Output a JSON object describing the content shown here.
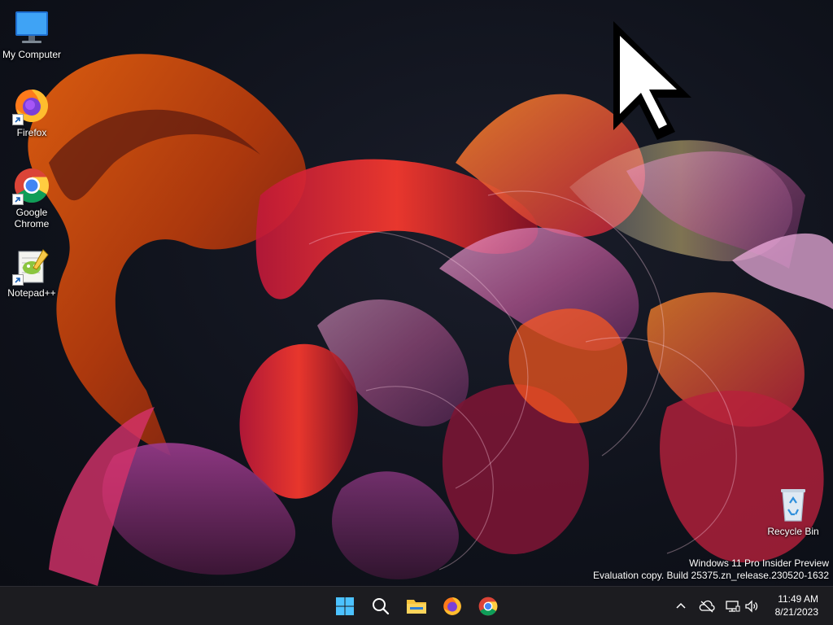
{
  "desktop": {
    "icons": [
      {
        "label": "My Computer",
        "icon": "computer-icon"
      },
      {
        "label": "Firefox",
        "icon": "firefox-icon",
        "shortcut": true
      },
      {
        "label": "Google Chrome",
        "icon": "chrome-icon",
        "shortcut": true
      },
      {
        "label": "Notepad++",
        "icon": "notepadpp-icon",
        "shortcut": true
      },
      {
        "label": "Recycle Bin",
        "icon": "recycle-bin-icon"
      }
    ],
    "watermark": {
      "line1": "Windows 11 Pro Insider Preview",
      "line2": "Evaluation copy. Build 25375.zn_release.230520-1632"
    }
  },
  "taskbar": {
    "pinned": [
      {
        "name": "start-button",
        "icon": "windows-logo-icon"
      },
      {
        "name": "search-button",
        "icon": "search-icon"
      },
      {
        "name": "file-explorer-button",
        "icon": "folder-icon"
      },
      {
        "name": "firefox-taskbar-button",
        "icon": "firefox-icon"
      },
      {
        "name": "chrome-taskbar-button",
        "icon": "chrome-icon"
      }
    ],
    "tray": {
      "icons": [
        "chevron-up-icon",
        "onedrive-offline-icon",
        "network-icon",
        "volume-icon"
      ],
      "time": "11:49 AM",
      "date": "8/21/2023"
    }
  },
  "colors": {
    "accent": "#4cc2ff",
    "taskbar_bg": "#1c1c20",
    "desktop_bg": "#10131c"
  }
}
